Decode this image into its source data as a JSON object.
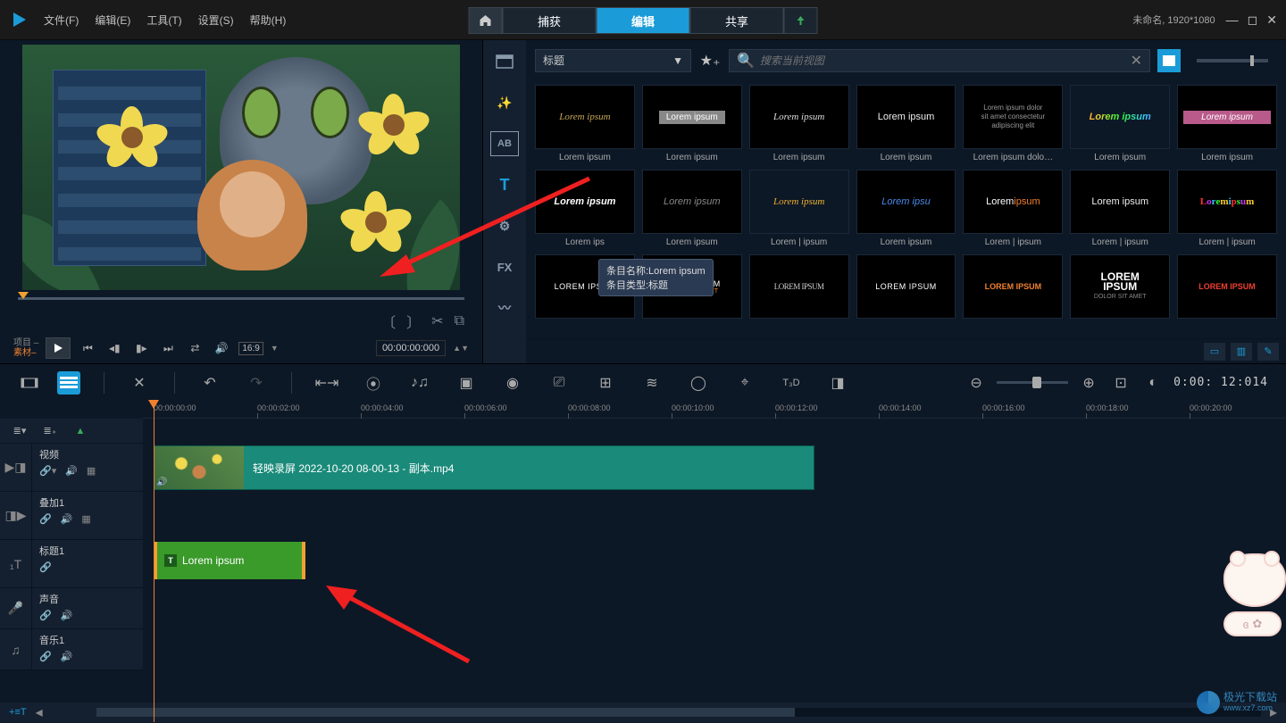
{
  "titlebar": {
    "menu": {
      "file": "文件(F)",
      "edit": "编辑(E)",
      "tools": "工具(T)",
      "settings": "设置(S)",
      "help": "帮助(H)"
    },
    "tabs": {
      "capture": "捕获",
      "edit": "编辑",
      "share": "共享"
    },
    "project": "未命名, 1920*1080"
  },
  "preview": {
    "project_label": "项目 –",
    "material_label": "素材–",
    "aspect": "16:9",
    "timecode": "00:00:00:000"
  },
  "library": {
    "dropdown": "标题",
    "search_placeholder": "搜索当前视图",
    "items": [
      {
        "label": "Lorem ipsum",
        "style": "th-gold",
        "text": "Lorem ipsum"
      },
      {
        "label": "Lorem ipsum",
        "style": "th-banner",
        "text": "Lorem ipsum"
      },
      {
        "label": "Lorem ipsum",
        "style": "th-script",
        "text": "Lorem ipsum"
      },
      {
        "label": "Lorem ipsum",
        "style": "th-white",
        "text": "Lorem ipsum"
      },
      {
        "label": "Lorem ipsum dolo…",
        "style": "th-lines",
        "text": "Lorem ipsum dolor\nsit amet consectetur\nadipiscing elit"
      },
      {
        "label": "Lorem ipsum",
        "style": "th-rainbow",
        "text": "Lorem ipsum"
      },
      {
        "label": "Lorem ipsum",
        "style": "th-pink",
        "text": "Lorem ipsum"
      },
      {
        "label": "Lorem ips",
        "style": "th-bolditalic",
        "text": "Lorem ipsum"
      },
      {
        "label": "Lorem ipsum",
        "style": "th-gray",
        "text": "Lorem ipsum"
      },
      {
        "label": "Lorem | ipsum",
        "style": "th-orange-script",
        "text": "Lorem ipsum"
      },
      {
        "label": "Lorem ipsum",
        "style": "th-blue",
        "text": "Lorem ipsu"
      },
      {
        "label": "Lorem | ipsum",
        "style": "th-split",
        "text": "Lorem ipsum"
      },
      {
        "label": "Lorem | ipsum",
        "style": "th-white",
        "text": "Lorem ipsum"
      },
      {
        "label": "Lorem | ipsum",
        "style": "th-rainbow2",
        "text": "Lorem ipsum"
      },
      {
        "label": "",
        "style": "th-upper",
        "text": "LOREM IPSUM"
      },
      {
        "label": "",
        "style": "th-upper-sub",
        "text": "LOREM IPSUM"
      },
      {
        "label": "",
        "style": "th-condensed",
        "text": "LOREM IPSUM"
      },
      {
        "label": "",
        "style": "th-upper",
        "text": "LOREM IPSUM"
      },
      {
        "label": "",
        "style": "th-upper-o",
        "text": "LOREM IPSUM"
      },
      {
        "label": "",
        "style": "th-stack",
        "text": "LOREM IPSUM"
      },
      {
        "label": "",
        "style": "th-red",
        "text": "LOREM IPSUM"
      }
    ]
  },
  "tooltip": {
    "line1": "条目名称:Lorem ipsum",
    "line2": "条目类型:标题"
  },
  "toolbar": {
    "t3d": "T₃D",
    "time": "0:00: 12:014"
  },
  "timeline": {
    "ticks": [
      "00:00:00:00",
      "00:00:02:00",
      "00:00:04:00",
      "00:00:06:00",
      "00:00:08:00",
      "00:00:10:00",
      "00:00:12:00",
      "00:00:14:00",
      "00:00:16:00",
      "00:00:18:00",
      "00:00:20:00"
    ],
    "tracks": {
      "video": "视频",
      "overlay": "叠加1",
      "title": "标题1",
      "sound": "声音",
      "music": "音乐1"
    },
    "video_clip": "轻映录屏 2022-10-20 08-00-13 - 副本.mp4",
    "title_clip": "Lorem ipsum",
    "add_track": "+≡T"
  },
  "watermark": {
    "name": "极光下载站",
    "url": "www.xz7.com"
  }
}
